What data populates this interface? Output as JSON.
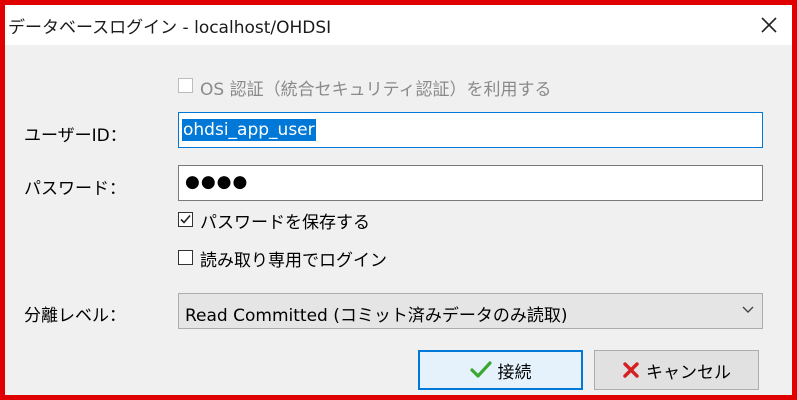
{
  "window": {
    "title": "データベースログイン - localhost/OHDSI",
    "close_icon": "close-icon"
  },
  "form": {
    "os_auth_label": "OS 認証（統合セキュリティ認証）を利用する",
    "os_auth_checked": false,
    "user_label": "ユーザーID：",
    "user_value": "ohdsi_app_user",
    "password_label": "パスワード：",
    "password_value": "●●●●",
    "save_password_label": "パスワードを保存する",
    "save_password_checked": true,
    "readonly_label": "読み取り専用でログイン",
    "readonly_checked": false,
    "isolation_label": "分離レベル：",
    "isolation_value": "Read Committed (コミット済みデータのみ読取)"
  },
  "buttons": {
    "connect_label": "接続",
    "cancel_label": "キャンセル"
  },
  "colors": {
    "frame": "#e00000",
    "accent": "#0078d7",
    "connect_icon": "#3aa832",
    "cancel_icon": "#d42020"
  }
}
